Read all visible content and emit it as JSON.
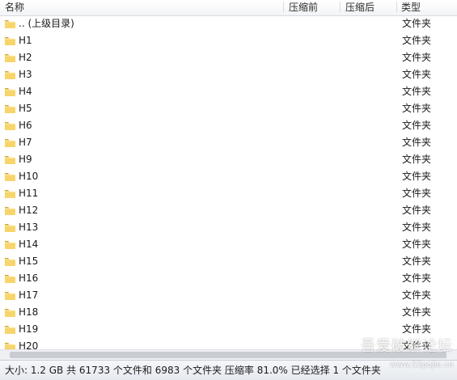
{
  "columns": {
    "name": "名称",
    "packed": "压缩前",
    "unpacked": "压缩后",
    "type": "类型"
  },
  "rows": [
    {
      "name": ".. (上级目录)",
      "type": "文件夹"
    },
    {
      "name": "H1",
      "type": "文件夹"
    },
    {
      "name": "H2",
      "type": "文件夹"
    },
    {
      "name": "H3",
      "type": "文件夹"
    },
    {
      "name": "H4",
      "type": "文件夹"
    },
    {
      "name": "H5",
      "type": "文件夹"
    },
    {
      "name": "H6",
      "type": "文件夹"
    },
    {
      "name": "H7",
      "type": "文件夹"
    },
    {
      "name": "H9",
      "type": "文件夹"
    },
    {
      "name": "H10",
      "type": "文件夹"
    },
    {
      "name": "H11",
      "type": "文件夹"
    },
    {
      "name": "H12",
      "type": "文件夹"
    },
    {
      "name": "H13",
      "type": "文件夹"
    },
    {
      "name": "H14",
      "type": "文件夹"
    },
    {
      "name": "H15",
      "type": "文件夹"
    },
    {
      "name": "H16",
      "type": "文件夹"
    },
    {
      "name": "H17",
      "type": "文件夹"
    },
    {
      "name": "H18",
      "type": "文件夹"
    },
    {
      "name": "H19",
      "type": "文件夹"
    },
    {
      "name": "H20",
      "type": "文件夹"
    }
  ],
  "status": "大小: 1.2 GB 共 61733 个文件和 6983 个文件夹 压缩率 81.0% 已经选择 1 个文件夹",
  "watermark": {
    "title": "吾爱破解论坛",
    "url": "www.52pojie.cn"
  },
  "icons": {
    "row_icon": "folder-icon"
  },
  "colors": {
    "folder_light": "#f7d56b",
    "folder_dark": "#dba52e"
  }
}
